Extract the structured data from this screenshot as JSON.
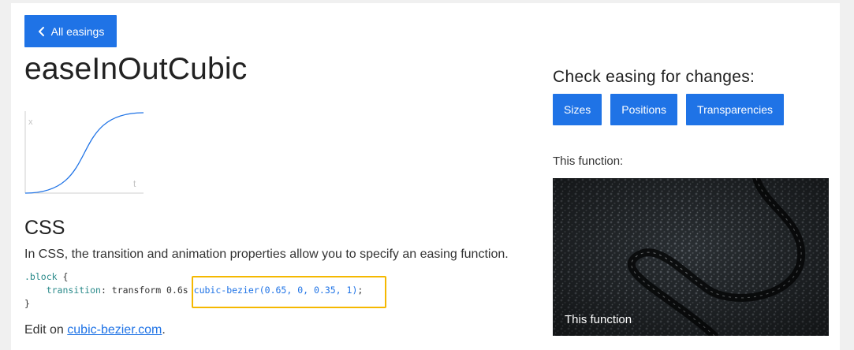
{
  "nav": {
    "back_label": "All easings"
  },
  "page": {
    "title": "easeInOutCubic"
  },
  "graph": {
    "x_axis_label": "x",
    "t_axis_label": "t"
  },
  "css_section": {
    "heading": "CSS",
    "description": "In CSS, the transition and animation properties allow you to specify an easing function.",
    "code": {
      "selector": ".block",
      "open_brace": "{",
      "property": "transition",
      "value_prefix": ": transform 0.6s ",
      "function": "cubic-bezier(0.65, 0, 0.35, 1)",
      "terminator": ";",
      "close_brace": "}"
    },
    "edit_prefix": "Edit on ",
    "edit_link": "cubic-bezier.com",
    "edit_suffix": "."
  },
  "check": {
    "heading": "Check easing for changes:",
    "buttons": [
      "Sizes",
      "Positions",
      "Transparencies"
    ]
  },
  "demo": {
    "label": "This function:",
    "caption": "This function"
  },
  "colors": {
    "accent": "#1f73e6",
    "highlight": "#f5b800"
  },
  "icons": {
    "back": "chevron-left-icon"
  }
}
